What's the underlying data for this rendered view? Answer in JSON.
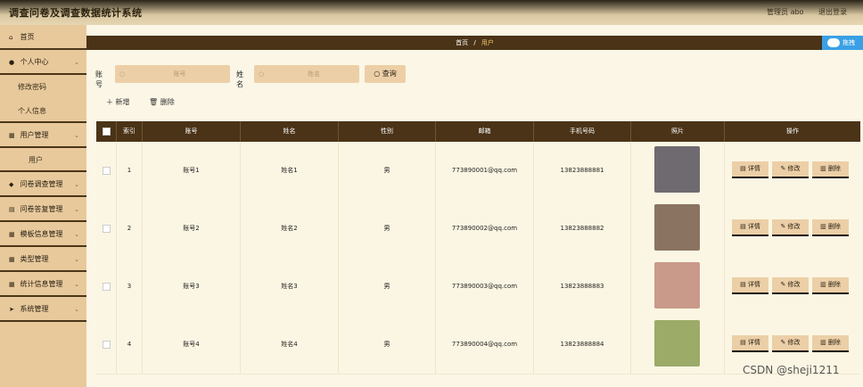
{
  "app_title": "调查问卷及调查数据统计系统",
  "topbar": {
    "admin_label": "管理员 abo",
    "logout_label": "退出登录"
  },
  "sidebar": {
    "items": [
      {
        "label": "首页",
        "icon": "home-icon",
        "has_chevron": false
      },
      {
        "label": "个人中心",
        "icon": "user-icon",
        "has_chevron": true
      },
      {
        "label": "用户管理",
        "icon": "grid-icon",
        "has_chevron": true
      },
      {
        "label": "问卷调查管理",
        "icon": "location-icon",
        "has_chevron": true
      },
      {
        "label": "问卷答复管理",
        "icon": "list-icon",
        "has_chevron": true
      },
      {
        "label": "模板信息管理",
        "icon": "grid-icon",
        "has_chevron": true
      },
      {
        "label": "类型管理",
        "icon": "grid-icon",
        "has_chevron": true
      },
      {
        "label": "统计信息管理",
        "icon": "grid-icon",
        "has_chevron": true
      },
      {
        "label": "系统管理",
        "icon": "send-icon",
        "has_chevron": true
      }
    ],
    "sub_personal": [
      "修改密码",
      "个人信息"
    ],
    "sub_user": [
      "用户"
    ]
  },
  "breadcrumb": {
    "home": "首页",
    "sep": "/",
    "current": "用户"
  },
  "corner_label": "拖拽",
  "search": {
    "account_label": "账号",
    "account_placeholder": "账号",
    "name_label": "姓名",
    "name_placeholder": "姓名",
    "button_label": "查询"
  },
  "toolbar": {
    "add_label": "新增",
    "delete_label": "删除"
  },
  "table": {
    "headers": [
      "索引",
      "账号",
      "姓名",
      "性别",
      "邮箱",
      "手机号码",
      "照片",
      "操作"
    ],
    "ops": {
      "detail": "详情",
      "edit": "修改",
      "delete": "删除"
    },
    "rows": [
      {
        "index": "1",
        "account": "账号1",
        "name": "姓名1",
        "gender": "男",
        "email": "773890001@qq.com",
        "phone": "13823888881",
        "photo_color": "#6f6a70"
      },
      {
        "index": "2",
        "account": "账号2",
        "name": "姓名2",
        "gender": "男",
        "email": "773890002@qq.com",
        "phone": "13823888882",
        "photo_color": "#8a7360"
      },
      {
        "index": "3",
        "account": "账号3",
        "name": "姓名3",
        "gender": "男",
        "email": "773890003@qq.com",
        "phone": "13823888883",
        "photo_color": "#c99a8a"
      },
      {
        "index": "4",
        "account": "账号4",
        "name": "姓名4",
        "gender": "男",
        "email": "773890004@qq.com",
        "phone": "13823888884",
        "photo_color": "#9cab68"
      }
    ]
  },
  "watermark": "CSDN @sheji1211"
}
